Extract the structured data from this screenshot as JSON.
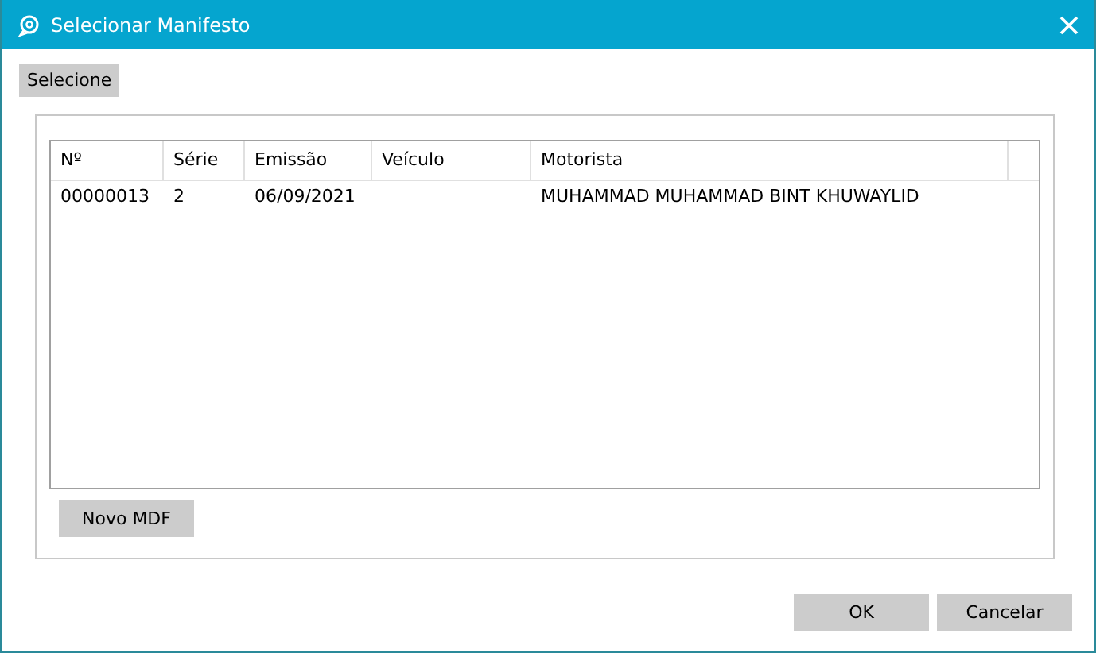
{
  "window": {
    "title": "Selecionar Manifesto"
  },
  "tabs": [
    {
      "label": "Selecione",
      "selected": true
    }
  ],
  "table": {
    "columns": [
      "Nº",
      "Série",
      "Emissão",
      "Veículo",
      "Motorista"
    ],
    "rows": [
      [
        "00000013",
        "2",
        "06/09/2021",
        "",
        "MUHAMMAD MUHAMMAD BINT KHUWAYLID"
      ]
    ]
  },
  "new_button": "Novo MDF",
  "buttons": [
    "OK",
    "Cancelar"
  ]
}
